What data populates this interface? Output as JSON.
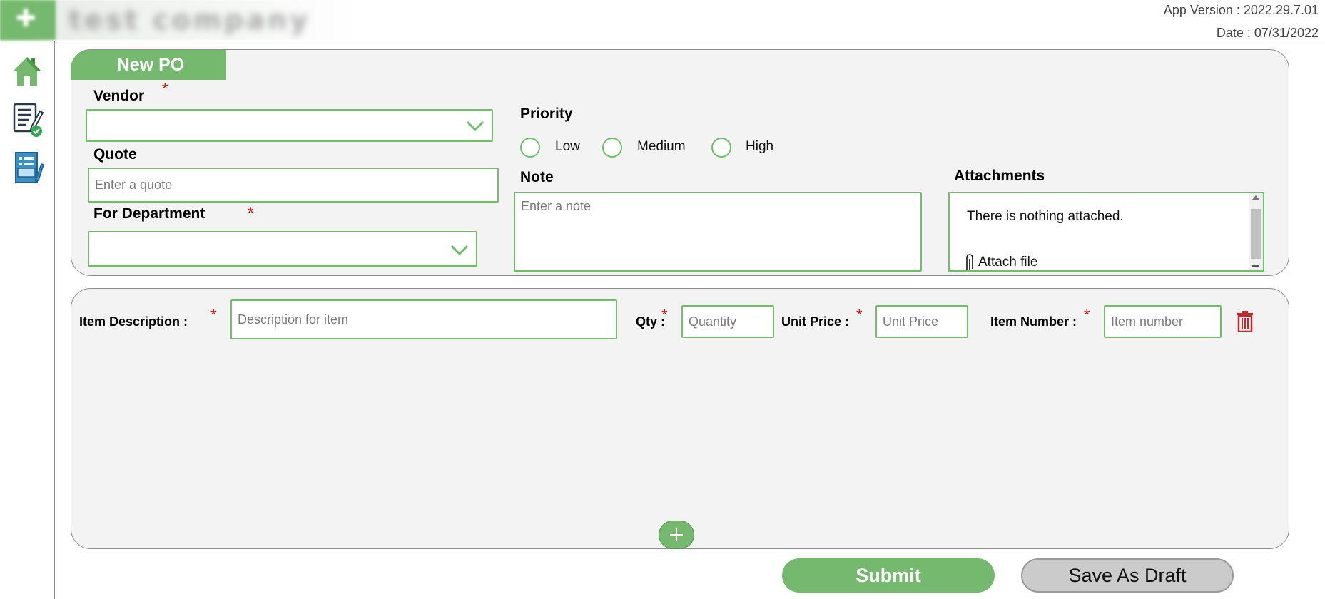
{
  "header": {
    "logo_text": "test company",
    "app_version": "App Version : 2022.29.7.01",
    "date": "Date : 07/31/2022"
  },
  "sidebar": {
    "items": [
      {
        "icon": "home-icon"
      },
      {
        "icon": "document-approved-icon"
      },
      {
        "icon": "form-edit-icon"
      }
    ]
  },
  "form": {
    "tab_title": "New PO",
    "vendor": {
      "label": "Vendor",
      "required_mark": "*",
      "value": ""
    },
    "quote": {
      "label": "Quote",
      "placeholder": "Enter a quote",
      "value": ""
    },
    "department": {
      "label": "For Department",
      "required_mark": "*",
      "value": ""
    },
    "priority": {
      "label": "Priority",
      "options": [
        {
          "label": "Low"
        },
        {
          "label": "Medium"
        },
        {
          "label": "High"
        }
      ]
    },
    "note": {
      "label": "Note",
      "placeholder": "Enter a note"
    },
    "attachments": {
      "label": "Attachments",
      "empty_text": "There is nothing attached.",
      "attach_link": "Attach file"
    }
  },
  "items": {
    "description": {
      "label": "Item Description :",
      "required_mark": "*",
      "placeholder": "Description for item"
    },
    "qty": {
      "label": "Qty :",
      "required_mark": "*",
      "placeholder": "Quantity"
    },
    "unit_price": {
      "label": "Unit Price :",
      "required_mark": "*",
      "placeholder": "Unit Price"
    },
    "item_number": {
      "label": "Item Number :",
      "required_mark": "*",
      "placeholder": "Item number"
    }
  },
  "actions": {
    "submit": "Submit",
    "save_draft": "Save As Draft"
  },
  "colors": {
    "accent": "#75b96f",
    "field_border": "#6fbf6a",
    "required": "#e00000",
    "delete": "#c0282a",
    "panel_bg": "#f3f3f3"
  }
}
